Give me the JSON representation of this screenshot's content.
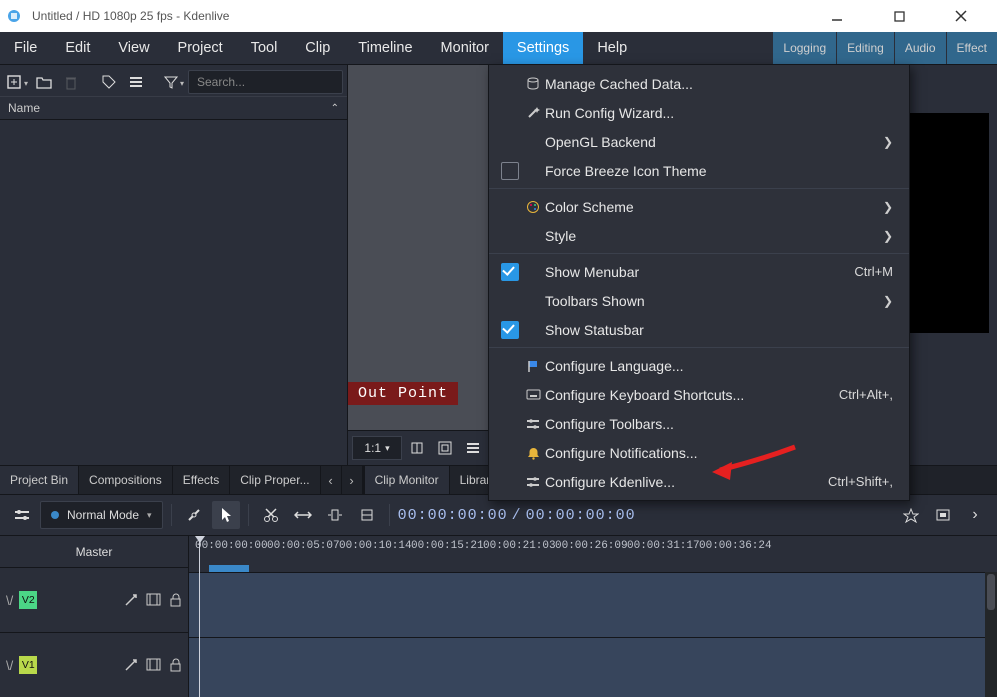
{
  "title": "Untitled / HD 1080p 25 fps - Kdenlive",
  "menubar": {
    "items": [
      "File",
      "Edit",
      "View",
      "Project",
      "Tool",
      "Clip",
      "Timeline",
      "Monitor",
      "Settings",
      "Help"
    ],
    "active_index": 8,
    "right_buttons": [
      "Logging",
      "Editing",
      "Audio",
      "Effect"
    ]
  },
  "bin": {
    "search_placeholder": "Search...",
    "header": "Name"
  },
  "monitor": {
    "out_point_label": "Out Point",
    "scale_label": "1:1"
  },
  "tabs": {
    "left": [
      "Project Bin",
      "Compositions",
      "Effects",
      "Clip Proper..."
    ],
    "left_active": 0,
    "right": [
      "Clip Monitor",
      "Library"
    ],
    "right_active": 0
  },
  "timeline_toolbar": {
    "mode_label": "Normal Mode",
    "tc_left": "00:00:00:00",
    "tc_sep": " / ",
    "tc_right": "00:00:00:00"
  },
  "timeline": {
    "master_label": "Master",
    "tracks": [
      {
        "id": "V2",
        "class": "v2"
      },
      {
        "id": "V1",
        "class": "v1"
      }
    ],
    "ruler_ticks": [
      "00:00:00:00",
      "00:00:05:07",
      "00:00:10:14",
      "00:00:15:21",
      "00:00:21:03",
      "00:00:26:09",
      "00:00:31:17",
      "00:00:36:24"
    ]
  },
  "settings_menu": {
    "items": [
      {
        "icon": "db",
        "label": "Manage Cached Data..."
      },
      {
        "icon": "wand",
        "label": "Run Config Wizard..."
      },
      {
        "label": "OpenGL Backend",
        "submenu": true
      },
      {
        "check": false,
        "label": "Force Breeze Icon Theme"
      },
      {
        "sep": true
      },
      {
        "icon": "palette",
        "label": "Color Scheme",
        "submenu": true
      },
      {
        "label": "Style",
        "submenu": true
      },
      {
        "sep": true
      },
      {
        "check": true,
        "label": "Show Menubar",
        "accel": "Ctrl+M"
      },
      {
        "label": "Toolbars Shown",
        "submenu": true
      },
      {
        "check": true,
        "label": "Show Statusbar"
      },
      {
        "sep": true
      },
      {
        "icon": "flag",
        "label": "Configure Language..."
      },
      {
        "icon": "kbd",
        "label": "Configure Keyboard Shortcuts...",
        "accel": "Ctrl+Alt+,"
      },
      {
        "icon": "tools",
        "label": "Configure Toolbars..."
      },
      {
        "icon": "bell",
        "label": "Configure Notifications..."
      },
      {
        "icon": "gear",
        "label": "Configure Kdenlive...",
        "accel": "Ctrl+Shift+,"
      }
    ]
  }
}
